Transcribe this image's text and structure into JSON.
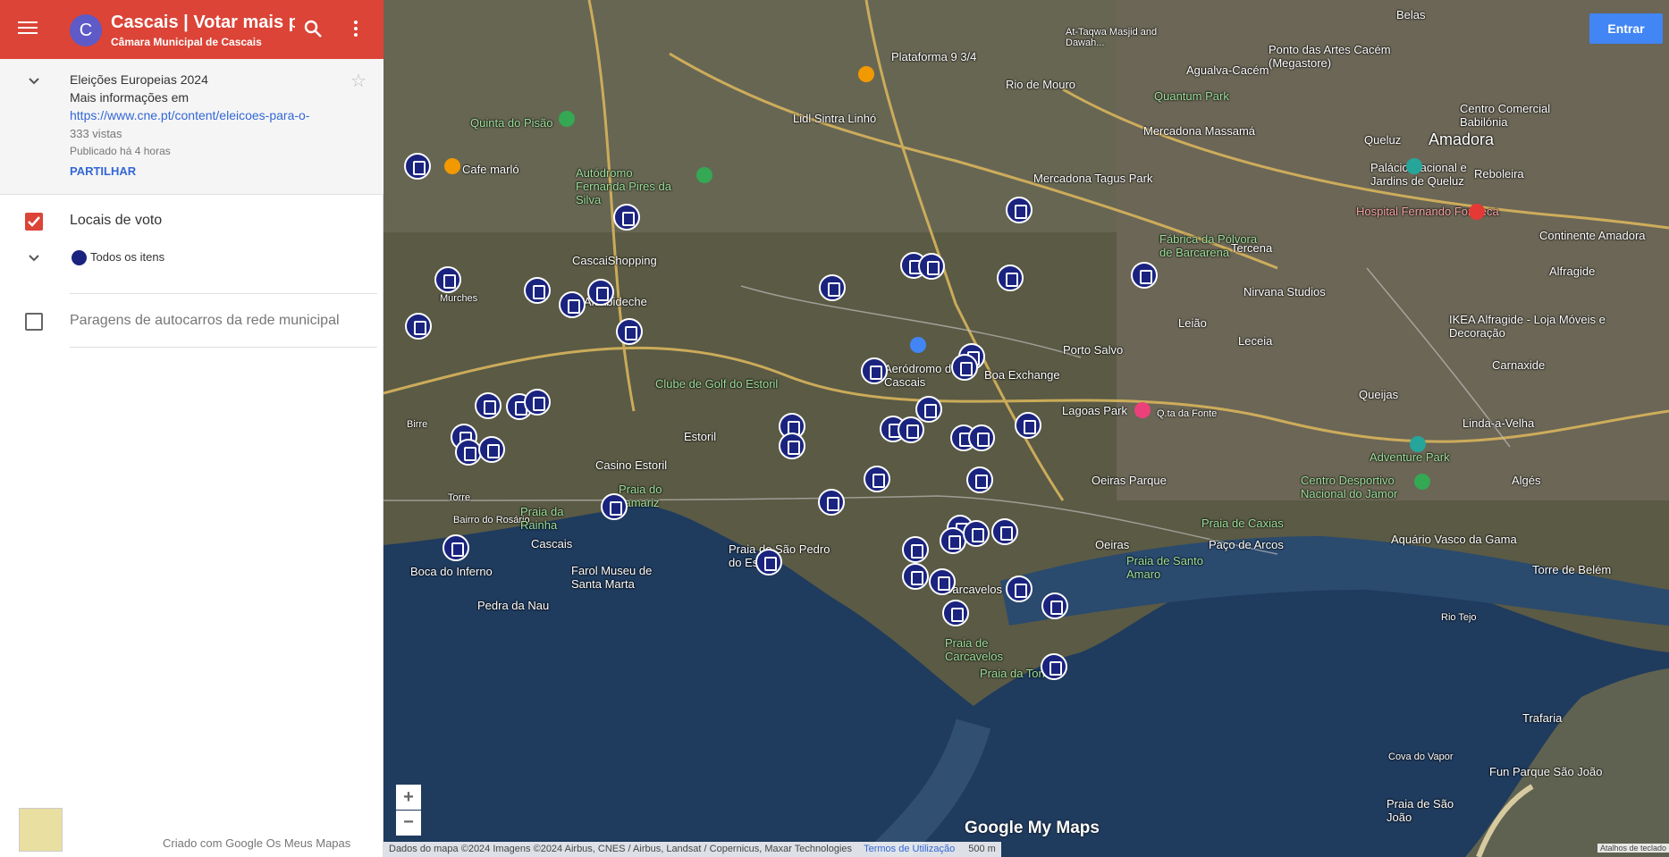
{
  "topbar": {
    "avatar_letter": "C",
    "title": "Cascais | Votar mais p...",
    "owner": "Câmara Municipal de Cascais"
  },
  "info": {
    "heading": "Eleições Europeias 2024",
    "more": "Mais informações em",
    "link": "https://www.cne.pt/content/eleicoes-para-o-",
    "views": "333 vistas",
    "published": "Publicado há 4 horas",
    "share": "PARTILHAR"
  },
  "layers": [
    {
      "title": "Locais de voto",
      "checked": true,
      "item": "Todos os itens"
    },
    {
      "title": "Paragens de autocarros da rede municipal",
      "checked": false
    }
  ],
  "footer": {
    "credit": "Criado com Google Os Meus Mapas"
  },
  "map": {
    "signin": "Entrar",
    "zoom_in": "+",
    "zoom_out": "−",
    "logo": "Google My Maps",
    "attribution": "Dados do mapa ©2024 Imagens ©2024 Airbus, CNES / Airbus, Landsat / Copernicus, Maxar Technologies",
    "terms": "Termos de Utilização",
    "scale": "500 m",
    "shortcuts": "Atalhos de teclado",
    "colors": {
      "sea": "#1f3b5e",
      "land": "#5a5a45",
      "header": "#db4437",
      "marker": "#1a237e"
    },
    "labels": [
      "Amadora",
      "Queluz",
      "Reboleira",
      "Belas",
      "Agualva-Cacém",
      "Rio de Mouro",
      "Mercadona Massamá",
      "Mercadona Tagus Park",
      "Quinta do Pisão",
      "Cafe marló",
      "Autódromo Fernanda Pires da Silva",
      "CascaiShopping",
      "Alcabideche",
      "Murches",
      "Birre",
      "Torre",
      "Bairro do Rosário",
      "Cascais",
      "Boca do Inferno",
      "Pedra da Nau",
      "Farol Museu de Santa Marta",
      "Casino Estoril",
      "Estoril",
      "Praia do Tamariz",
      "Praia da Rainha",
      "Praia de São Pedro do Estoril",
      "Aeródromo de Cascais",
      "Lagoas Park",
      "Porto Salvo",
      "Leião",
      "Leceia",
      "Tercena",
      "Nirvana Studios",
      "Oeiras Parque",
      "Oeiras",
      "Paço de Arcos",
      "Praia de Caxias",
      "Centro Desportivo Nacional do Jamor",
      "Adventure Park",
      "Linda-a-Velha",
      "Carnaxide",
      "Queijas",
      "Algés",
      "Aquário Vasco da Gama",
      "Torre de Belém",
      "Rio Tejo",
      "Trafaria",
      "Cova do Vapor",
      "Fun Parque São João",
      "Praia de São João",
      "Praia de Carcavelos",
      "Carcavelos",
      "Praia da Torre",
      "Praia de Santo Amaro",
      "Clube de Golf do Estoril",
      "Centro Comercial Babilónia",
      "Hospital Fernando Fonseca",
      "Continente Amadora",
      "Alfragide",
      "IKEA Alfragide - Loja Móveis e Decoração",
      "Fábrica da Pólvora de Barcarena",
      "Quantum Park",
      "Ponto das Artes Cacém (Megastore)",
      "Plataforma 9 3/4",
      "Lidl Sintra Linhó",
      "At-Taqwa Masjid and Dawah...",
      "Palácio Nacional e Jardins de Queluz",
      "Q.ta da Fonte",
      "Boa Exchange"
    ]
  }
}
